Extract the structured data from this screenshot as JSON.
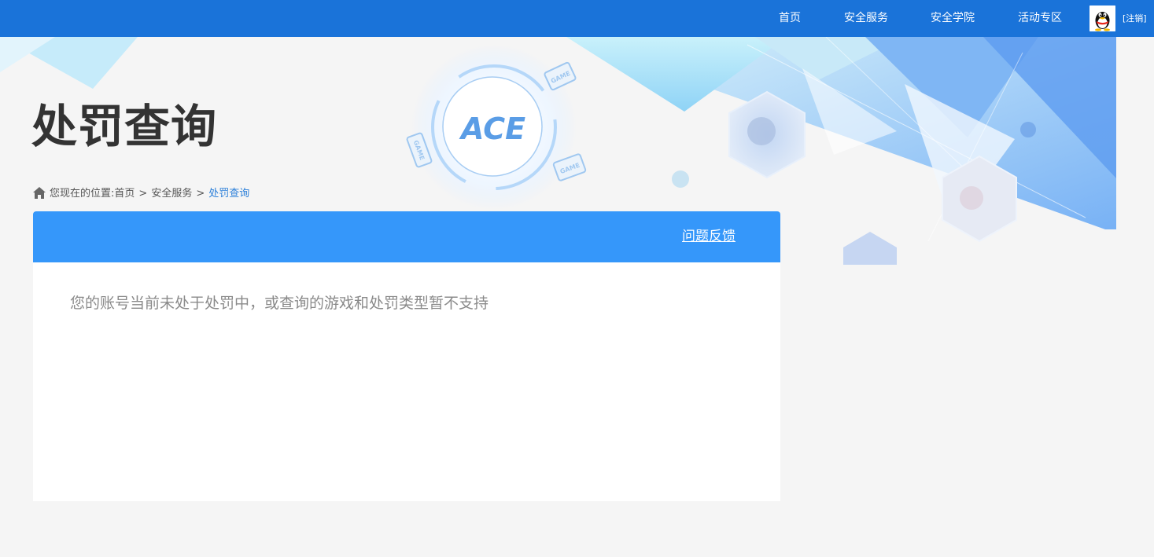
{
  "nav": {
    "items": [
      {
        "label": "首页"
      },
      {
        "label": "安全服务"
      },
      {
        "label": "安全学院"
      },
      {
        "label": "活动专区"
      }
    ],
    "logout_label": "[注销]",
    "avatar_icon": "qq-penguin-icon"
  },
  "banner": {
    "logo_text": "ACE",
    "game_badge_text": "GAME"
  },
  "page": {
    "title": "处罚查询"
  },
  "breadcrumb": {
    "prefix": "您现在的位置:",
    "items": [
      {
        "label": "首页"
      },
      {
        "label": "安全服务"
      },
      {
        "label": "处罚查询"
      }
    ],
    "separator": ">"
  },
  "panel": {
    "feedback_label": "问题反馈",
    "notice": "您的账号当前未处于处罚中，或查询的游戏和处罚类型暂不支持"
  },
  "colors": {
    "topbar": "#1a73d9",
    "panel_header": "#3597fa",
    "accent_link": "#2b7fd9",
    "background": "#f5f5f5"
  }
}
